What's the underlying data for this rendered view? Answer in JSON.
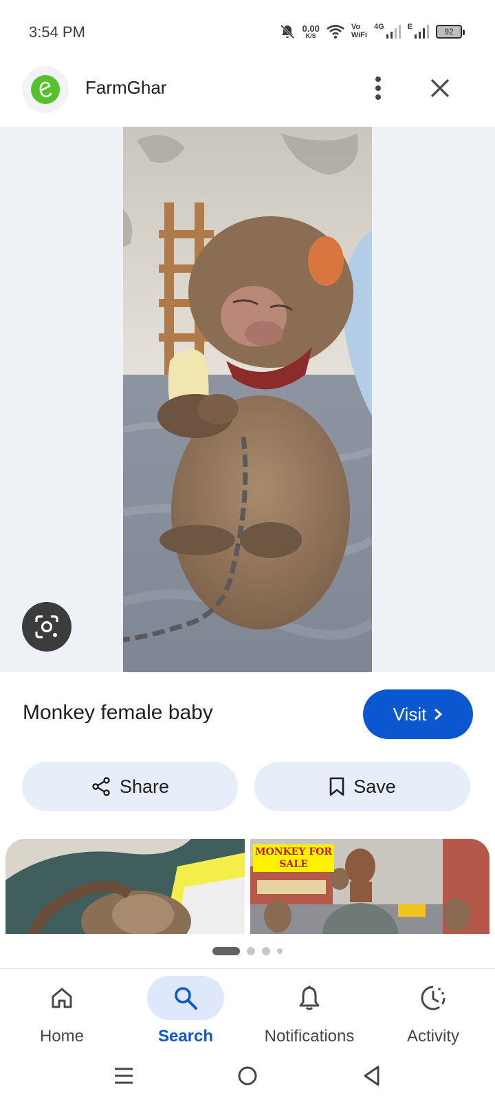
{
  "status_bar": {
    "time": "3:54 PM",
    "net_speed_value": "0.00",
    "net_speed_unit": "K/S",
    "vo_label_top": "Vo",
    "vo_label_bottom": "WiFi",
    "signal1_label": "4G",
    "signal2_label": "E",
    "battery": "92"
  },
  "header": {
    "site_name": "FarmGhar",
    "logo_icon": "farmghar-logo-icon",
    "more_icon": "more-vert-icon",
    "close_icon": "close-icon"
  },
  "image": {
    "subject": "baby-monkey-photo",
    "lens_icon": "google-lens-icon"
  },
  "result": {
    "title": "Monkey female baby",
    "visit_label": "Visit"
  },
  "actions": {
    "share_label": "Share",
    "save_label": "Save"
  },
  "related": {
    "thumb2_banner_line1": "MONKEY FOR",
    "thumb2_banner_line2": "SALE"
  },
  "pager": {
    "pages": 4,
    "active": 1
  },
  "bottom_nav": {
    "items": [
      {
        "label": "Home",
        "icon": "home-icon"
      },
      {
        "label": "Search",
        "icon": "search-icon",
        "active": true
      },
      {
        "label": "Notifications",
        "icon": "bell-icon"
      },
      {
        "label": "Activity",
        "icon": "activity-icon"
      }
    ]
  },
  "colors": {
    "accent": "#0b57d0",
    "button_bg": "#e8eef9",
    "image_bg": "#eef1f5",
    "logo_green": "#55c22c"
  }
}
